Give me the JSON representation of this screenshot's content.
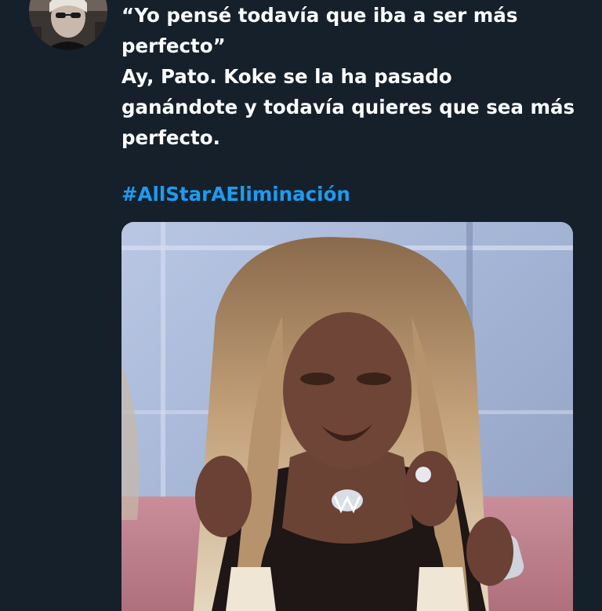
{
  "tweet": {
    "text_lines": [
      "“Yo pensé todavía que iba a ser más",
      "perfecto”",
      "Ay, Pato. Koke se la ha pasado",
      "ganándote y todavía quieres que sea más",
      "perfecto."
    ],
    "hashtag": "#AllStarAEliminación",
    "hashtag_color": "#1d9bf0",
    "background_color": "#15202b",
    "text_color": "#ffffff"
  },
  "avatar": {
    "icon": "user-avatar-photo"
  },
  "media": {
    "icon": "meme-photo"
  }
}
